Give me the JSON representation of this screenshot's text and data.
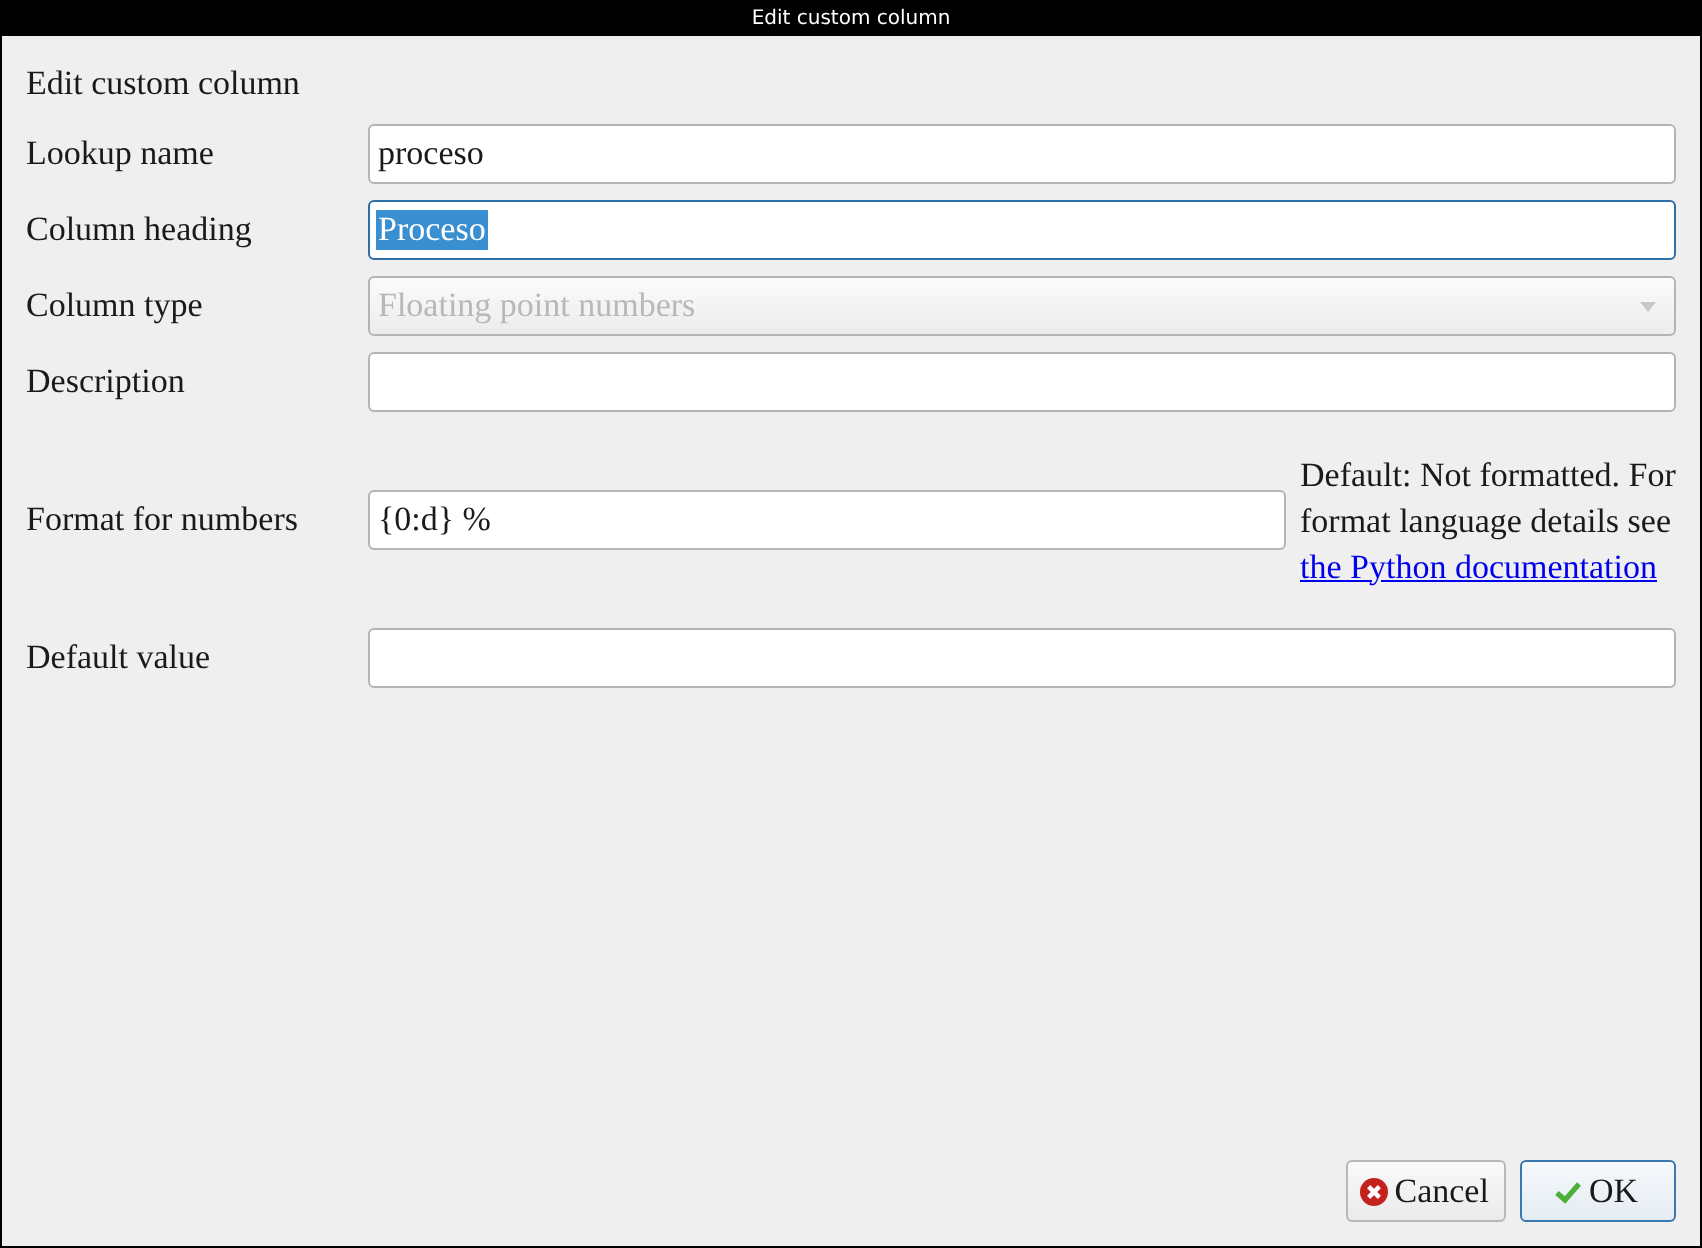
{
  "window": {
    "title": "Edit custom column"
  },
  "heading": "Edit custom column",
  "fields": [
    {
      "kind": "text",
      "label": "Lookup name",
      "value": "proceso",
      "focused": false
    },
    {
      "kind": "text",
      "label": "Column heading",
      "value": "Proceso",
      "focused": true
    },
    {
      "kind": "dropdown",
      "label": "Column type",
      "value": "Floating point numbers",
      "disabled": true
    },
    {
      "kind": "text",
      "label": "Description",
      "focused": false
    },
    {
      "kind": "text",
      "label": "Format for numbers",
      "value": "{0:d} %",
      "focused": false,
      "help": {
        "text": "Default: Not formatted. For format language details see ",
        "link": "the Python documentation"
      }
    },
    {
      "kind": "text",
      "label": "Default value",
      "focused": false
    }
  ],
  "buttons": [
    {
      "kind": "cancel",
      "label": "Cancel",
      "default": false
    },
    {
      "kind": "ok",
      "label": "OK",
      "default": true
    }
  ]
}
